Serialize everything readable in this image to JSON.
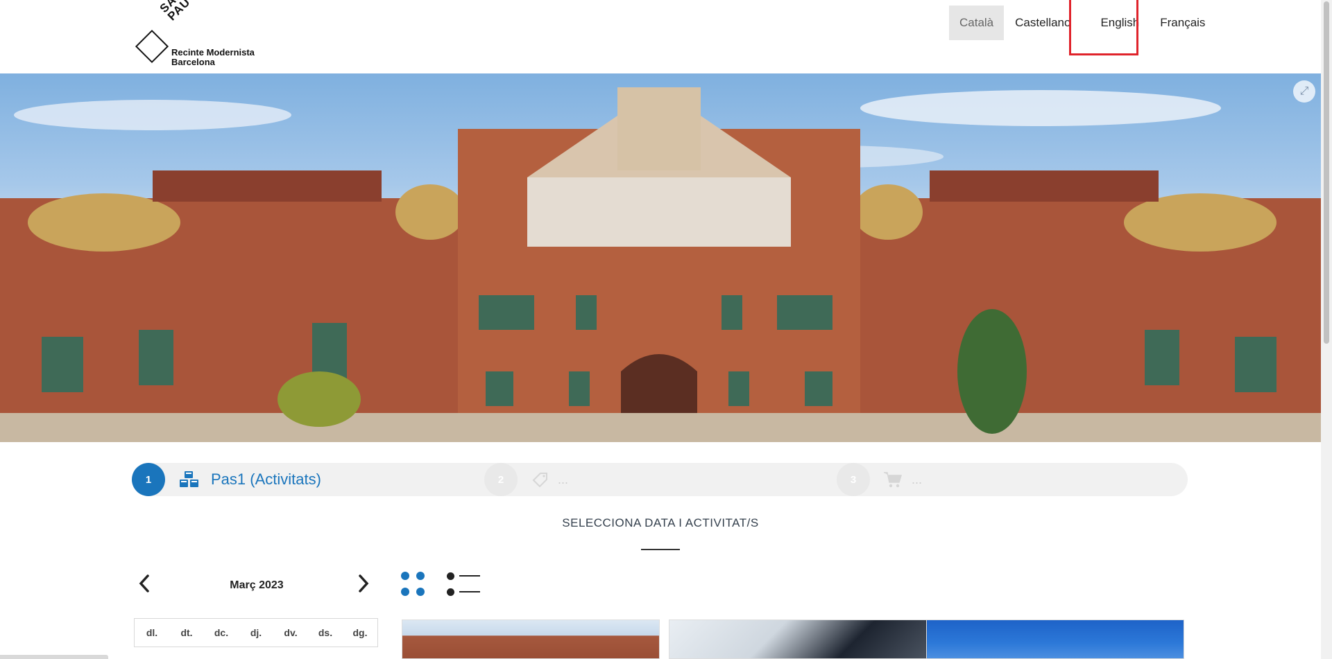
{
  "logo": {
    "sant_pau": "SANT PAU",
    "line1": "Recinte Modernista",
    "line2": "Barcelona"
  },
  "languages": [
    {
      "label": "Català",
      "active": true
    },
    {
      "label": "Castellano",
      "active": false
    },
    {
      "label": "English",
      "active": false
    },
    {
      "label": "Français",
      "active": false
    }
  ],
  "hero": {
    "alt": "Hospital de Sant Pau modernist pavilions"
  },
  "steps": [
    {
      "number": "1",
      "label": "Pas1 (Activitats)",
      "active": true,
      "icon": "cubes-icon"
    },
    {
      "number": "2",
      "label": "...",
      "active": false,
      "icon": "ticket-icon"
    },
    {
      "number": "3",
      "label": "...",
      "active": false,
      "icon": "cart-icon"
    }
  ],
  "section": {
    "title": "SELECCIONA DATA I ACTIVITAT/S"
  },
  "calendar": {
    "month": "Març 2023",
    "weekdays": [
      "dl.",
      "dt.",
      "dc.",
      "dj.",
      "dv.",
      "ds.",
      "dg."
    ]
  },
  "colors": {
    "accent": "#1a75bc",
    "highlight": "#e0232b"
  }
}
